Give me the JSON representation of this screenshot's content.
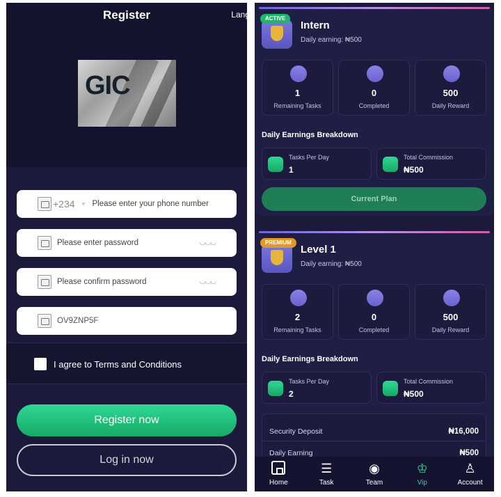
{
  "left": {
    "title": "Register",
    "lang": "Lang",
    "logo_text": "GIC",
    "phone": {
      "prefix": "+234",
      "placeholder": "Please enter your phone number"
    },
    "password": {
      "placeholder": "Please enter password"
    },
    "confirm_password": {
      "placeholder": "Please confirm password"
    },
    "invite_code": {
      "value": "OV9ZNP5F"
    },
    "agree_label": "I agree to Terms and Conditions",
    "register_button": "Register now",
    "login_button": "Log in now"
  },
  "right": {
    "plans": [
      {
        "badge": "ACTIVE",
        "name": "Intern",
        "earning": "Daily earning: ₦500",
        "stats": [
          {
            "value": "1",
            "label": "Remaining Tasks"
          },
          {
            "value": "0",
            "label": "Completed"
          },
          {
            "value": "500",
            "label": "Daily Reward"
          }
        ],
        "breakdown_title": "Daily Earnings Breakdown",
        "breakdown": [
          {
            "label": "Tasks Per Day",
            "value": "1"
          },
          {
            "label": "Total Commission",
            "value": "₦500"
          }
        ],
        "button": "Current Plan"
      },
      {
        "badge": "PREMIUM",
        "name": "Level 1",
        "earning": "Daily earning: ₦500",
        "stats": [
          {
            "value": "2",
            "label": "Remaining Tasks"
          },
          {
            "value": "0",
            "label": "Completed"
          },
          {
            "value": "500",
            "label": "Daily Reward"
          }
        ],
        "breakdown_title": "Daily Earnings Breakdown",
        "breakdown": [
          {
            "label": "Tasks Per Day",
            "value": "2"
          },
          {
            "label": "Total Commission",
            "value": "₦500"
          }
        ],
        "details": [
          {
            "label": "Security Deposit",
            "value": "₦16,000"
          },
          {
            "label": "Daily Earning",
            "value": "₦500"
          }
        ]
      }
    ],
    "nav": [
      {
        "label": "Home",
        "icon": "home-icon"
      },
      {
        "label": "Task",
        "icon": "sliders-icon"
      },
      {
        "label": "Team",
        "icon": "user-circle-icon"
      },
      {
        "label": "Vip",
        "icon": "crown-icon"
      },
      {
        "label": "Account",
        "icon": "person-icon"
      }
    ]
  },
  "colors": {
    "accent": "#2ed894",
    "background": "#1b1a3a",
    "card": "#1f1e44"
  }
}
